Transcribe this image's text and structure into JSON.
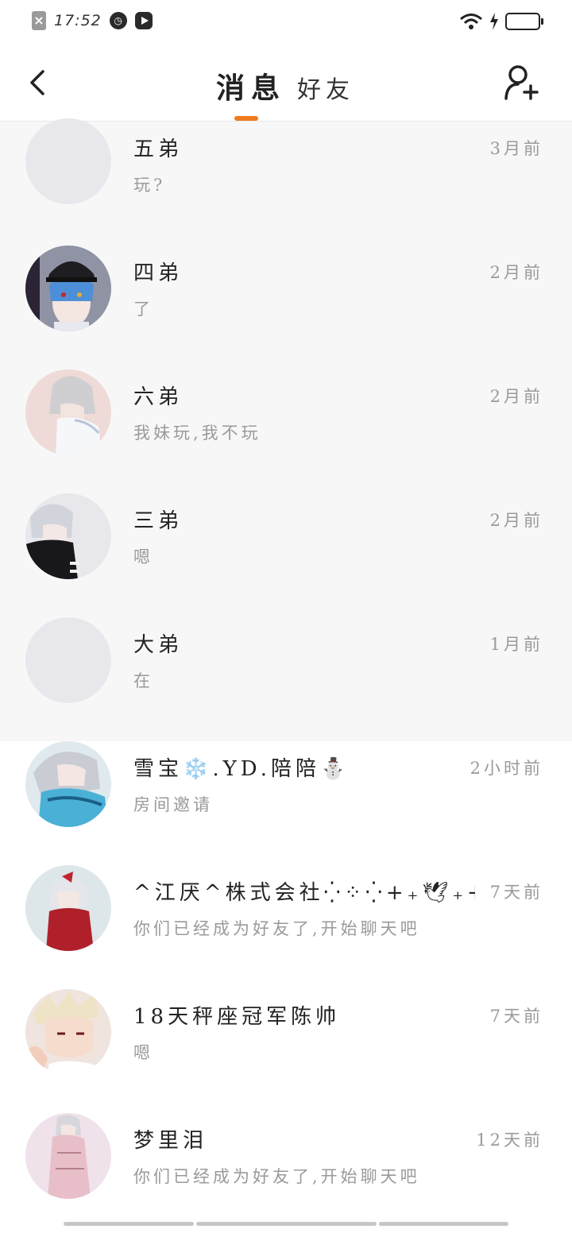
{
  "status_bar": {
    "time": "17:52",
    "notif_icons": [
      "close-notification-icon",
      "clock-icon",
      "play-icon"
    ],
    "right_icons": [
      "wifi-icon",
      "charging-icon",
      "battery-icon"
    ]
  },
  "header": {
    "tabs": [
      {
        "label": "消息",
        "active": true
      },
      {
        "label": "好友",
        "active": false
      }
    ],
    "accent_color": "#f07a1d"
  },
  "conversations": [
    {
      "name": "五弟",
      "message": "玩?",
      "time": "3月前",
      "pinned": true,
      "avatar": "blank-avatar"
    },
    {
      "name": "四弟",
      "message": "了",
      "time": "2月前",
      "pinned": true,
      "avatar": "blue-hair-cap-avatar"
    },
    {
      "name": "六弟",
      "message": "我妹玩,我不玩",
      "time": "2月前",
      "pinned": true,
      "avatar": "white-hair-avatar"
    },
    {
      "name": "三弟",
      "message": "嗯",
      "time": "2月前",
      "pinned": true,
      "avatar": "white-hair-black-coat-avatar"
    },
    {
      "name": "大弟",
      "message": "在",
      "time": "1月前",
      "pinned": true,
      "avatar": "blank-avatar"
    },
    {
      "name": "雪宝❄️.YD.陪陪⛄",
      "message": "房间邀请",
      "time": "2小时前",
      "pinned": false,
      "avatar": "silver-hair-blue-dress-avatar"
    },
    {
      "name": "^江厌^株式会社⁛⁘⁛+₊🕊₊+⁛⁘⁛",
      "message": "你们已经成为好友了,开始聊天吧",
      "time": "7天前",
      "pinned": false,
      "avatar": "red-dress-avatar"
    },
    {
      "name": "18天秤座冠军陈帅",
      "message": "嗯",
      "time": "7天前",
      "pinned": false,
      "avatar": "anime-boy-avatar"
    },
    {
      "name": "梦里泪",
      "message": "你们已经成为好友了,开始聊天吧",
      "time": "12天前",
      "pinned": false,
      "avatar": "pink-dress-avatar"
    }
  ]
}
